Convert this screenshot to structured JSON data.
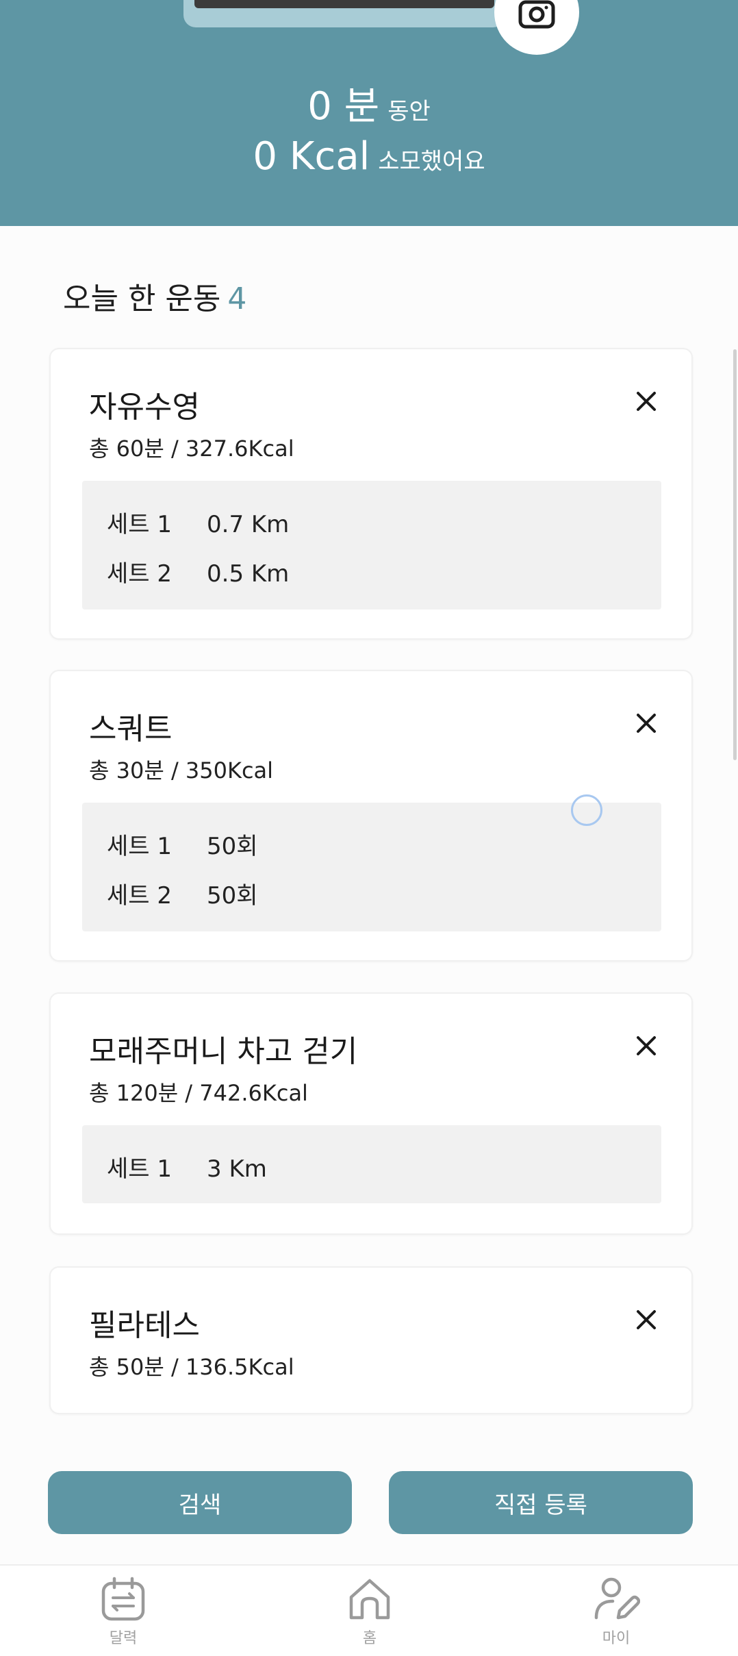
{
  "header": {
    "minutes_value": "0 분",
    "minutes_suffix": "동안",
    "kcal_value": "0 Kcal",
    "kcal_suffix": "소모했어요"
  },
  "section": {
    "title": "오늘 한 운동",
    "count": "4"
  },
  "workouts": [
    {
      "name": "자유수영",
      "summary": "총 60분 / 327.6Kcal",
      "sets": [
        {
          "label": "세트 1",
          "value": "0.7 Km"
        },
        {
          "label": "세트 2",
          "value": "0.5 Km"
        }
      ]
    },
    {
      "name": "스쿼트",
      "summary": "총 30분 / 350Kcal",
      "sets": [
        {
          "label": "세트 1",
          "value": "50회"
        },
        {
          "label": "세트 2",
          "value": "50회"
        }
      ]
    },
    {
      "name": "모래주머니 차고 걷기",
      "summary": "총 120분 / 742.6Kcal",
      "sets": [
        {
          "label": "세트 1",
          "value": "3 Km"
        }
      ]
    },
    {
      "name": "필라테스",
      "summary": "총 50분 / 136.5Kcal",
      "sets": []
    }
  ],
  "actions": {
    "search_label": "검색",
    "register_label": "직접 등록"
  },
  "nav": {
    "calendar_label": "달력",
    "home_label": "홈",
    "my_label": "마이"
  },
  "icons": {
    "camera": "camera-icon",
    "close": "close-icon",
    "calendar": "calendar-icon",
    "home": "home-icon",
    "my": "user-edit-icon"
  },
  "colors": {
    "accent": "#5e96a4",
    "background": "#fcfcfc",
    "set_box": "#f1f1f1"
  }
}
